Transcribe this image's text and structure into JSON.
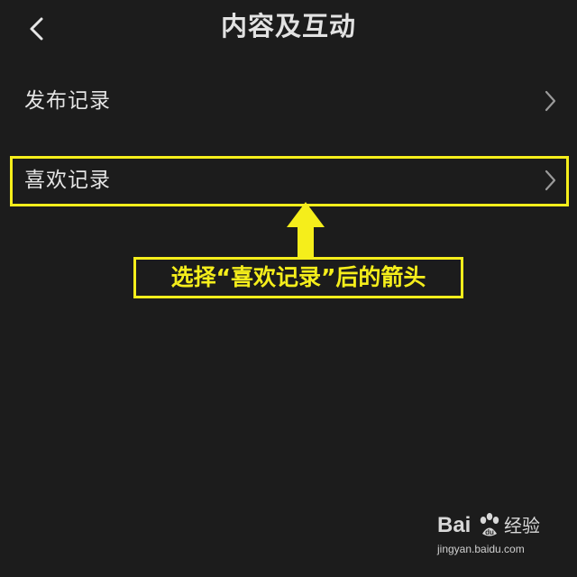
{
  "header": {
    "title": "内容及互动",
    "back_icon": "chevron-left-icon"
  },
  "list": {
    "items": [
      {
        "label": "发布记录",
        "icon": "chevron-right-icon"
      },
      {
        "label": "喜欢记录",
        "icon": "chevron-right-icon"
      }
    ]
  },
  "annotation": {
    "callout_text": "选择“喜欢记录”后的箭头",
    "highlight_color": "#f5ee1b",
    "arrow_icon": "up-arrow-icon"
  },
  "watermark": {
    "brand_bai": "Bai",
    "brand_jingyan": "经验",
    "url": "jingyan.baidu.com",
    "paw_icon": "baidu-paw-icon"
  },
  "colors": {
    "background": "#1c1c1c",
    "text": "#e4e4e4",
    "chevron": "#9a9a9a",
    "annotation": "#f5ee1b"
  }
}
